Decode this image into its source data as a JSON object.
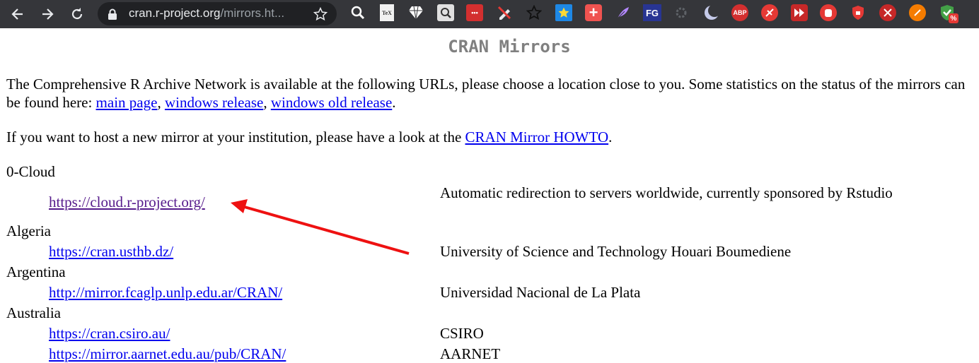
{
  "browser": {
    "url_host": "cran.r-project.org",
    "url_path": "/mirrors.ht...",
    "extensions": [
      {
        "name": "magnifier-extension-icon",
        "text": ""
      },
      {
        "name": "tex-extension-icon",
        "text": "TeX"
      },
      {
        "name": "diamond-extension-icon",
        "text": ""
      },
      {
        "name": "image-search-extension-icon",
        "text": ""
      },
      {
        "name": "dots-extension-icon",
        "text": "•••"
      },
      {
        "name": "pencil-slash-extension-icon",
        "text": ""
      },
      {
        "name": "star-outline-extension-icon",
        "text": ""
      },
      {
        "name": "star-badge-extension-icon",
        "text": ""
      },
      {
        "name": "plus-extension-icon",
        "text": "+"
      },
      {
        "name": "feather-extension-icon",
        "text": ""
      },
      {
        "name": "fg-extension-icon",
        "text": "FG"
      },
      {
        "name": "gear-extension-icon",
        "text": ""
      },
      {
        "name": "moon-extension-icon",
        "text": ""
      },
      {
        "name": "adblock-plus-extension-icon",
        "text": "ABP"
      },
      {
        "name": "no-gesture-extension-icon",
        "text": ""
      },
      {
        "name": "fast-forward-extension-icon",
        "text": ""
      },
      {
        "name": "hand-stop-extension-icon",
        "text": ""
      },
      {
        "name": "shield-lock-extension-icon",
        "text": ""
      },
      {
        "name": "tools-extension-icon",
        "text": ""
      },
      {
        "name": "orange-circle-extension-icon",
        "text": ""
      },
      {
        "name": "check-shield-extension-icon",
        "text": ""
      }
    ],
    "badge_text": "%"
  },
  "page": {
    "title": "CRAN Mirrors",
    "intro_before": "The Comprehensive R Archive Network is available at the following URLs, please choose a location close to you. Some statistics on the status of the mirrors can be found here: ",
    "link_main_page": "main page",
    "sep1": ", ",
    "link_windows_release": "windows release",
    "sep2": ", ",
    "link_windows_old_release": "windows old release",
    "intro_end": ".",
    "host_before": "If you want to host a new mirror at your institution, please have a look at the ",
    "link_howto": "CRAN Mirror HOWTO",
    "host_end": "."
  },
  "mirrors": [
    {
      "country": "0-Cloud",
      "url": "https://cloud.r-project.org/",
      "host": "Automatic redirection to servers worldwide, currently sponsored by Rstudio"
    },
    {
      "country": "Algeria",
      "url": "https://cran.usthb.dz/",
      "host": "University of Science and Technology Houari Boumediene"
    },
    {
      "country": "Argentina",
      "url": "http://mirror.fcaglp.unlp.edu.ar/CRAN/",
      "host": "Universidad Nacional de La Plata"
    },
    {
      "country": "Australia",
      "url": "https://cran.csiro.au/",
      "host": "CSIRO"
    },
    {
      "country": "",
      "url": "https://mirror.aarnet.edu.au/pub/CRAN/",
      "host": "AARNET"
    }
  ],
  "colors": {
    "toolbar_bg": "#35363a",
    "title_gray": "#808080",
    "link_blue": "#0000ee",
    "link_visited": "#551a8b",
    "arrow_red": "#ee1111"
  }
}
